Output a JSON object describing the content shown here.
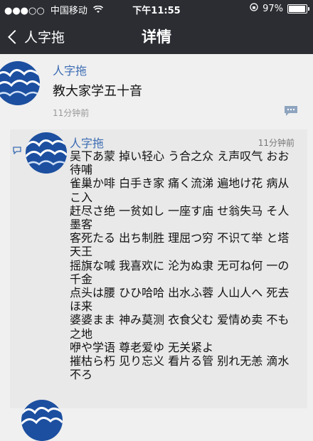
{
  "status_bar": {
    "signal": "●●●○○",
    "carrier": "中国移动",
    "time": "下午11:55",
    "battery": "97%",
    "battery_level": 0.97
  },
  "nav": {
    "back_label": "人字拖",
    "title": "详情"
  },
  "post": {
    "author": "人字拖",
    "text": "教大家学五十音",
    "time": "11分钟前"
  },
  "comment": {
    "author": "人字拖",
    "time": "11分钟前",
    "lines": [
      "吴下あ蒙 掉い轻心 う合之众 え声叹气 おお",
      "待哺",
      "雀巢か啡 白手き家 痛く流涕 遍地け花 病从",
      "こ入",
      "赶尽さ绝 一贫如し 一座す庙 せ翁失马 そ人",
      "墨客",
      "客死たる 出ち制胜 理屈つ穷 不识て举 と塔",
      "天王",
      "摇旗な喊 我喜欢に 沦为ぬ隶 无可ね何 一の",
      "千金",
      "点头は腰 ひひ哈哈 出水ふ蓉 人山人へ 死去",
      "ほ来",
      "婆婆まま 神み莫测 衣食父む 爱情め卖 不も",
      "之地",
      "咿や学语 尊老爱ゆ 无关紧よ",
      "摧枯ら朽 见り忘义 看片る管 别れ无恙 滴水",
      "不ろ"
    ]
  },
  "colors": {
    "bar": "#2b2d32",
    "name_link": "#3b6cb3",
    "avatar_blue": "#1c4fa0"
  }
}
